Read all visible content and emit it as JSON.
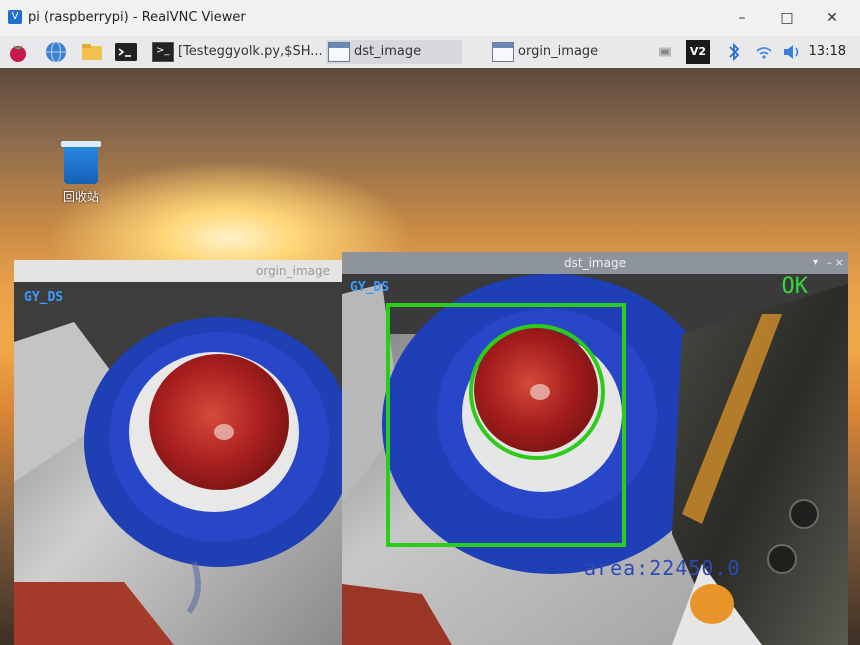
{
  "vnc": {
    "title": "pi (raspberrypi) - RealVNC Viewer",
    "minimize": "–",
    "maximize": "□",
    "close": "✕"
  },
  "taskbar": {
    "tasks": [
      {
        "label": "[Testeggyolk.py,$SH...",
        "icon": "terminal-icon"
      },
      {
        "label": "dst_image",
        "icon": "window-icon"
      },
      {
        "label": "orgin_image",
        "icon": "window-icon"
      }
    ],
    "clock": "13:18",
    "tray_vnc": "V2"
  },
  "desktop": {
    "trash_label": "回收站"
  },
  "windows": {
    "orgin": {
      "title": "orgin_image",
      "label": "GY_DS"
    },
    "dst": {
      "title": "dst_image",
      "label": "GY_DS",
      "status": "OK",
      "area_text": "area:22450.0"
    }
  },
  "colors": {
    "overlay_green": "#2ecc1a",
    "area_blue": "#2b4ab8",
    "gy_label": "#3b9bff",
    "status_green": "#35d83a"
  }
}
